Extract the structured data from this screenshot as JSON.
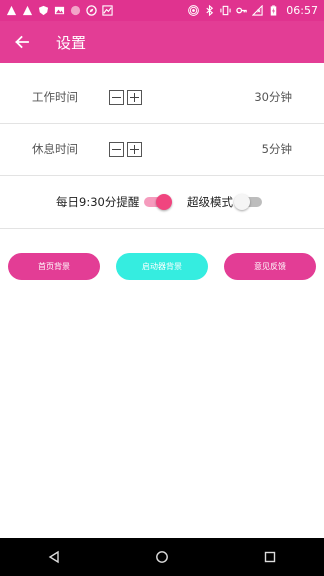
{
  "status_bar": {
    "time": "06:57",
    "left_icons": [
      "warning-icon",
      "warning-icon",
      "shield-icon",
      "image-icon",
      "circle-icon",
      "compass-icon",
      "chart-icon"
    ],
    "right_icons": [
      "hotspot-icon",
      "bluetooth-icon",
      "vibrate-icon",
      "key-icon",
      "no-signal-icon",
      "battery-charging-icon"
    ]
  },
  "app_bar": {
    "title": "设置",
    "back_icon": "arrow-left-icon",
    "color": "#e33d95"
  },
  "settings": {
    "work_time": {
      "label": "工作时间",
      "value": "30分钟"
    },
    "rest_time": {
      "label": "休息时间",
      "value": "5分钟"
    }
  },
  "toggles": {
    "daily_reminder": {
      "label": "每日9:30分提醒",
      "on": true
    },
    "super_mode": {
      "label": "超级模式",
      "on": false
    }
  },
  "buttons": {
    "home_background": "首页背景",
    "launch_background": "启动器背景",
    "feedback": "意见反馈"
  },
  "colors": {
    "accent": "#e33d95",
    "cyan": "#35ede0",
    "switch_on": "#f0457f"
  },
  "nav_bar": {
    "icons": [
      "back-triangle-icon",
      "home-circle-icon",
      "recents-square-icon"
    ]
  }
}
